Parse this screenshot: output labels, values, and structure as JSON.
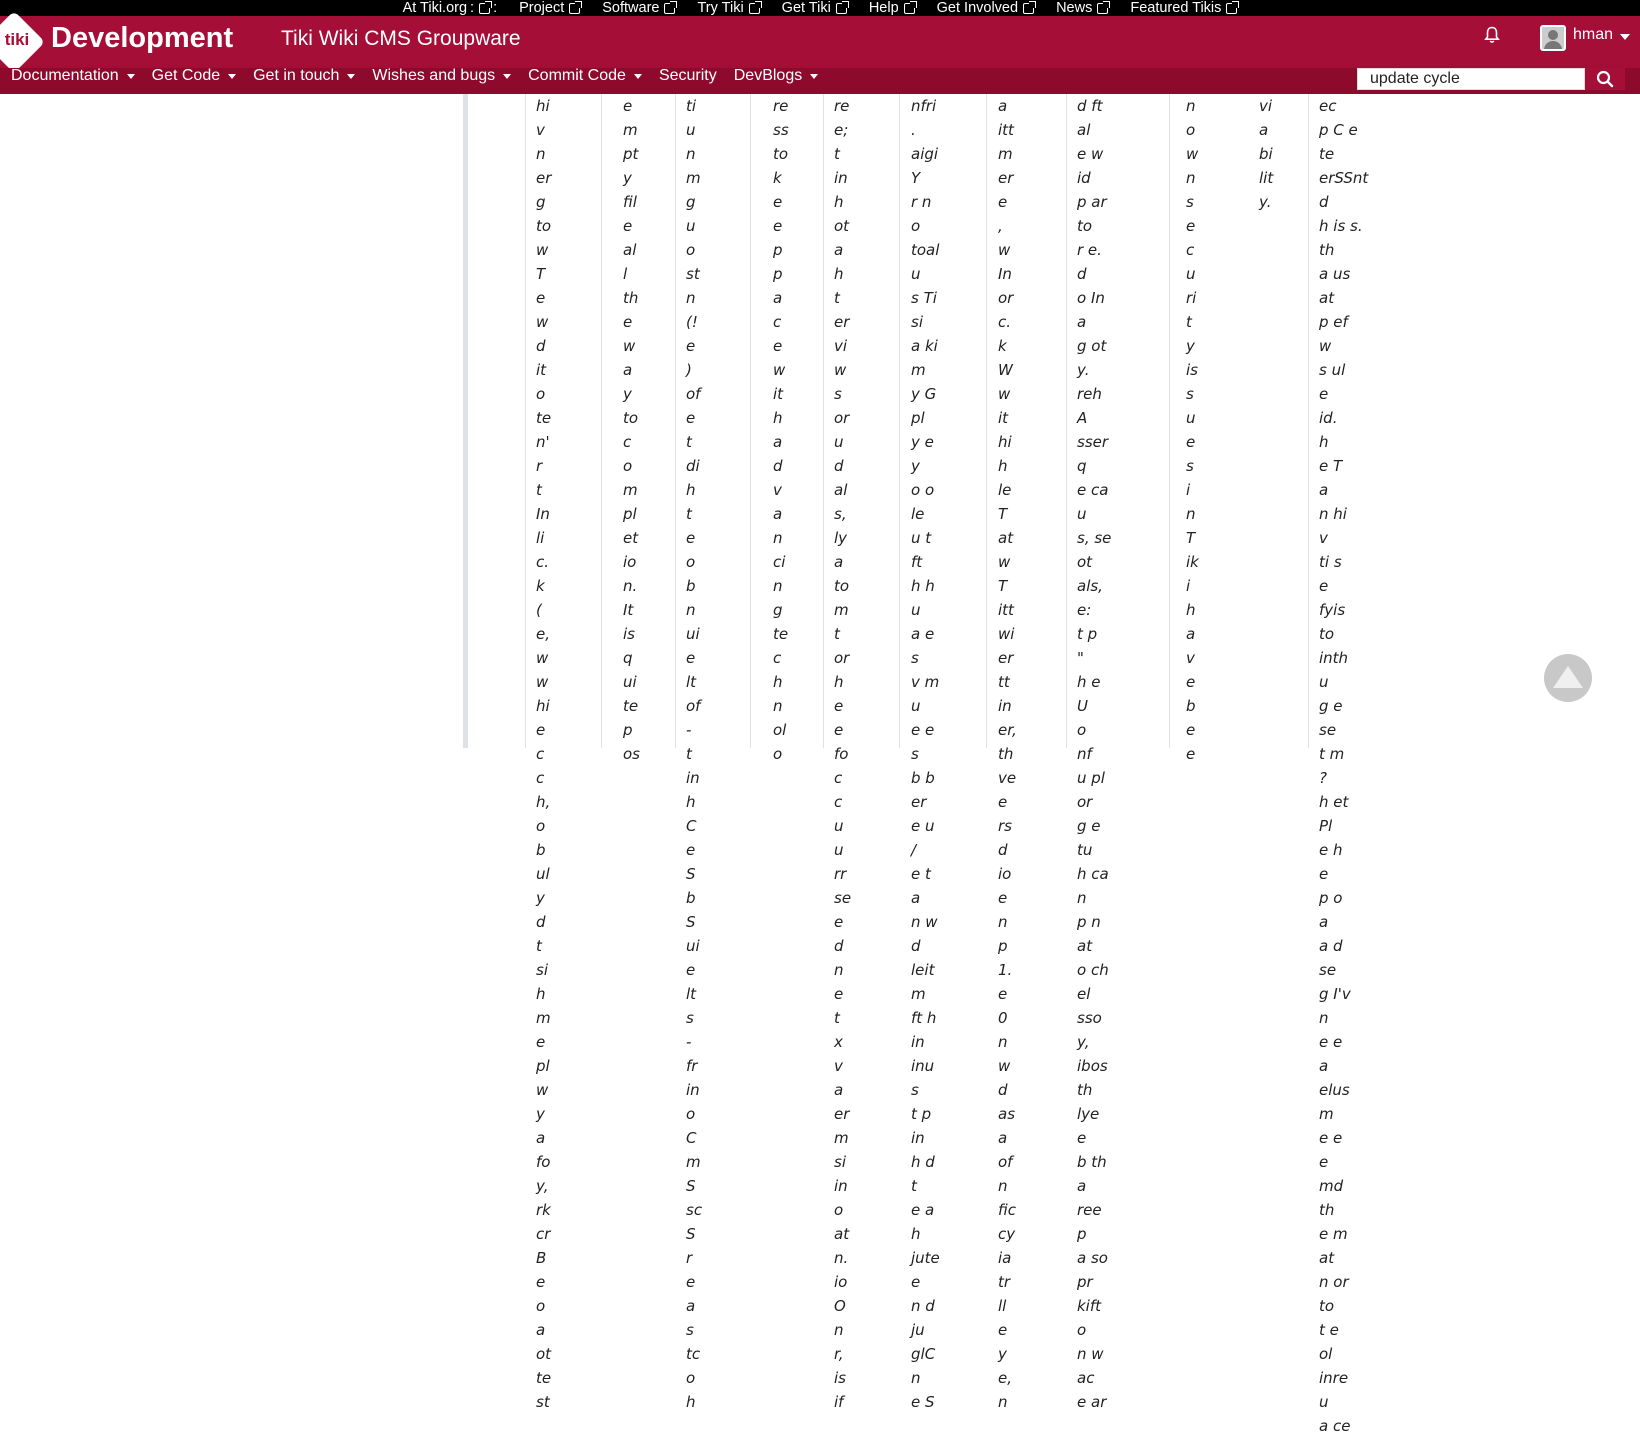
{
  "topbar": {
    "links": [
      "At Tiki.org",
      "Project",
      "Software",
      "Try Tiki",
      "Get Tiki",
      "Help",
      "Get Involved",
      "News",
      "Featured Tikis"
    ]
  },
  "header": {
    "logo_text": "tiki",
    "brand": "Development",
    "site_title": "Tiki Wiki CMS Groupware",
    "username": "hman",
    "colors": {
      "header_red": "#a50e37",
      "nav_red": "#8e0a2d"
    }
  },
  "nav": {
    "items": [
      {
        "label": "Documentation",
        "dropdown": true
      },
      {
        "label": "Get Code",
        "dropdown": true
      },
      {
        "label": "Get in touch",
        "dropdown": true
      },
      {
        "label": "Wishes and bugs",
        "dropdown": true
      },
      {
        "label": "Commit Code",
        "dropdown": true
      },
      {
        "label": "Security",
        "dropdown": false
      },
      {
        "label": "DevBlogs",
        "dropdown": true
      }
    ],
    "search_value": "update cycle"
  },
  "columns": [
    {
      "lines": [
        "hi",
        "v",
        "n",
        "er",
        "g",
        "to",
        "w",
        "T",
        "e",
        "w",
        "d",
        "it",
        "o",
        "te",
        "n'",
        "r",
        "t",
        "In",
        "li",
        "c.",
        "k",
        "(",
        "e,",
        "w",
        "w",
        "hi",
        "e",
        "c",
        "c",
        "h,",
        "o",
        "b",
        "ul",
        "y",
        "d",
        "t",
        "si",
        "h",
        "m",
        "e",
        "pl",
        "w",
        "y",
        "a",
        "fo",
        "y,",
        "rk",
        "cr",
        "B",
        "e",
        "o",
        "a",
        "ot",
        "te",
        "st"
      ]
    },
    {
      "lines": [
        "e",
        "m",
        "pt",
        "y",
        "fil",
        "e",
        "al",
        "l",
        "th",
        "e",
        "w",
        "a",
        "y",
        "to",
        "c",
        "o",
        "m",
        "pl",
        "et",
        "io",
        "n.",
        "It",
        "is",
        "q",
        "ui",
        "te",
        "p",
        "os"
      ]
    },
    {
      "lines": [
        "ti",
        "u",
        "n",
        "m",
        "g",
        "u",
        "o",
        "st",
        "n",
        "(!",
        "e",
        ")",
        "of",
        "e",
        "t",
        "di",
        "h",
        "t",
        "e",
        "o",
        "b",
        "n",
        "ui",
        "e",
        "lt",
        "of",
        "-",
        "t",
        "in",
        "h",
        "C",
        "e",
        "S",
        "b",
        "S",
        "ui",
        "e",
        "lt",
        "s",
        "-",
        "fr",
        "in",
        "o",
        "C",
        "m",
        "S",
        "sc",
        "S",
        "r",
        "e",
        "a",
        "s",
        "tc",
        "o",
        "h"
      ]
    },
    {
      "lines": [
        "re",
        "ss",
        "to",
        "k",
        "e",
        "e",
        "p",
        "p",
        "a",
        "c",
        "e",
        "w",
        "it",
        "h",
        "a",
        "d",
        "v",
        "a",
        "n",
        "ci",
        "n",
        "g",
        "te",
        "c",
        "h",
        "n",
        "ol",
        "o"
      ]
    },
    {
      "lines": [
        "re",
        "e;",
        "t",
        "in",
        "h",
        "ot",
        "a",
        "h",
        "t",
        "er",
        "vi",
        "w",
        "s",
        "or",
        "u",
        "d",
        "al",
        "s,",
        "ly",
        "a",
        "to",
        "m",
        "t",
        "or",
        "h",
        "e",
        "e",
        "fo",
        "c",
        "c",
        "u",
        "u",
        "rr",
        "se",
        "e",
        "d",
        "n",
        "e",
        "t",
        "x",
        "v",
        "a",
        "er",
        "m",
        "si",
        "in",
        "o",
        "at",
        "n.",
        "io",
        "O",
        "n",
        "r,",
        "is",
        "if"
      ]
    },
    {
      "lines": [
        "nfri",
        ".",
        "aigi",
        "Y",
        "r n",
        "o",
        "toal",
        "u",
        "s Ti",
        "si",
        "a ki",
        "m",
        "y G",
        "pl",
        "y e",
        "y",
        "o o",
        "le",
        "u t",
        "ft",
        "h h",
        "u",
        "a e",
        "s",
        "v m",
        "u",
        "e e",
        "s",
        "b b",
        "er",
        "e u",
        "/",
        "e t",
        "a",
        "n w",
        "d",
        "leit",
        "m",
        "ft h",
        "in",
        "inu",
        "s",
        "t p",
        "in",
        "h d",
        "t",
        "e a",
        "h",
        "jute",
        "e",
        "n d",
        "ju",
        "glC",
        "n",
        "e S"
      ]
    },
    {
      "lines": [
        "a",
        "itt",
        "m",
        "er",
        "e",
        ",",
        "w",
        "In",
        "or",
        "c.",
        "k",
        "W",
        "w",
        "it",
        "hi",
        "h",
        "le",
        "T",
        "at",
        "w",
        "T",
        "itt",
        "wi",
        "er",
        "tt",
        "in",
        "er,",
        "th",
        "ve",
        "e",
        "rs",
        "d",
        "io",
        "e",
        "n",
        "p",
        "1.",
        "e",
        "0",
        "n",
        "w",
        "d",
        "as",
        "a",
        "of",
        "n",
        "fic",
        "cy",
        "ia",
        "tr",
        "ll",
        "e",
        "y",
        "e,",
        "n"
      ]
    },
    {
      "lines": [
        "d ft",
        "al",
        "e w",
        "id",
        "p ar",
        "to",
        "r e.",
        "d",
        "o In",
        "a",
        "g ot",
        "y.",
        "reh",
        "A",
        "sser",
        "q",
        "e ca",
        "u",
        "s, se",
        "ot",
        "als,",
        "e:",
        "t p",
        "\"",
        "h e",
        "U",
        "o",
        "nf",
        "u pl",
        "or",
        "g e",
        "tu",
        "h ca",
        "n",
        "p n",
        "at",
        "o ch",
        "el",
        "sso",
        "y,",
        "ibos",
        "th",
        "lye",
        "e",
        "b th",
        "a",
        "ree",
        "p",
        "a so",
        "pr",
        "kift",
        "o",
        "n w",
        "ac",
        "e ar"
      ]
    },
    {
      "lines": [
        "n",
        "o",
        "w",
        "n",
        "s",
        "e",
        "c",
        "u",
        "ri",
        "t",
        "y",
        "is",
        "s",
        "u",
        "e",
        "s",
        "i",
        "n",
        "T",
        "ik",
        "i",
        "h",
        "a",
        "v",
        "e",
        "b",
        "e",
        "e"
      ]
    },
    {
      "lines": [
        "vi",
        "a",
        "bi",
        "lit",
        "y."
      ]
    },
    {
      "lines": [
        "ec",
        "p C e",
        "te",
        "erSSnt",
        "d",
        "h is s.",
        "th",
        "a us",
        "at",
        "p ef",
        "w",
        "s ul",
        "e",
        "id.",
        "h",
        "e T",
        "a",
        "n hi",
        "v",
        "ti s",
        "e",
        "fyis",
        "to",
        "inth",
        "u",
        "g e",
        "se",
        "t m",
        "?",
        "h et",
        "Pl",
        "e h",
        "e",
        "p o",
        "a",
        "a d",
        "se",
        "g I'v",
        "n",
        "e e",
        "a",
        "elus",
        "m",
        "e e",
        "e",
        "md",
        "th",
        "e m",
        "at",
        "n or",
        "to",
        "t e",
        "ol",
        "inre",
        "u",
        "a ce"
      ]
    }
  ]
}
